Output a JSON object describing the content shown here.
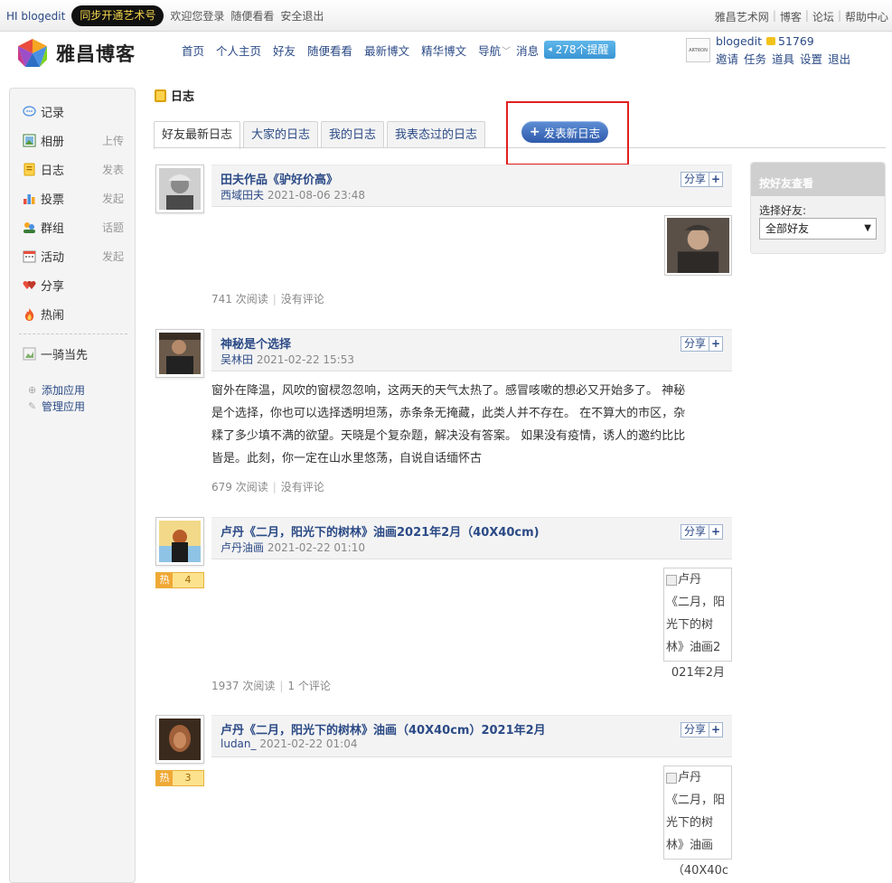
{
  "topbar": {
    "hi": "HI blogedit",
    "sync_pill": "同步开通艺术号",
    "welcome": "欢迎您登录",
    "random": "随便看看",
    "logout": "安全退出",
    "right_links": [
      "雅昌艺术网",
      "博客",
      "论坛",
      "帮助中心"
    ]
  },
  "header": {
    "logo_text": "雅昌博客",
    "nav": [
      "首页",
      "个人主页",
      "好友",
      "随便看看",
      "最新博文",
      "精华博文",
      "导航",
      "消息"
    ],
    "remind": "278个提醒",
    "user": {
      "avatar_text": "ARTRON 雅昌",
      "name": "blogedit",
      "coins": "51769",
      "links": [
        "邀请",
        "任务",
        "道具",
        "设置",
        "退出"
      ]
    }
  },
  "sidebar": {
    "items": [
      {
        "label": "记录",
        "sub": "",
        "icon": "record-icon"
      },
      {
        "label": "相册",
        "sub": "上传",
        "icon": "album-icon"
      },
      {
        "label": "日志",
        "sub": "发表",
        "icon": "blog-icon"
      },
      {
        "label": "投票",
        "sub": "发起",
        "icon": "vote-icon"
      },
      {
        "label": "群组",
        "sub": "话题",
        "icon": "group-icon"
      },
      {
        "label": "活动",
        "sub": "发起",
        "icon": "event-icon"
      },
      {
        "label": "分享",
        "sub": "",
        "icon": "share-icon"
      },
      {
        "label": "热闹",
        "sub": "",
        "icon": "hot-icon"
      }
    ],
    "app": "一骑当先",
    "add_app": "添加应用",
    "manage_app": "管理应用"
  },
  "content": {
    "title": "日志",
    "tabs": [
      "好友最新日志",
      "大家的日志",
      "我的日志",
      "我表态过的日志"
    ],
    "post_button": "发表新日志"
  },
  "feed": [
    {
      "title": "田夫作品《驴好价高》",
      "author": "西域田夫",
      "time": "2021-08-06 23:48",
      "body": "",
      "reads": "741 次阅读",
      "comments": "没有评论",
      "hot": ""
    },
    {
      "title": "神秘是个选择",
      "author": "吴林田",
      "time": "2021-02-22 15:53",
      "body_lines": [
        "窗外在降温，风吹的窗棂忽忽响，这两天的天气太热了。感冒咳嗽的想必又开始多了。 神秘",
        "是个选择，你也可以选择透明坦荡，赤条条无掩藏，此类人并不存在。 在不算大的市区，杂",
        "糅了多少填不满的欲望。天晓是个复杂题，解决没有答案。 如果没有疫情，诱人的邀约比比",
        "皆是。此刻，你一定在山水里悠荡，自说自话缅怀古"
      ],
      "reads": "679 次阅读",
      "comments": "没有评论",
      "hot": ""
    },
    {
      "title": "卢丹《二月，阳光下的树林》油画2021年2月（40X40cm)",
      "author": "卢丹油画",
      "time": "2021-02-22 01:10",
      "image_alt_lines": [
        "卢丹",
        "《二月，阳",
        "光下的树",
        "林》油画2",
        "021年2月"
      ],
      "reads": "1937 次阅读",
      "comments": "1 个评论",
      "hot_label": "热",
      "hot": "4"
    },
    {
      "title": "卢丹《二月，阳光下的树林》油画（40X40cm）2021年2月",
      "author": "ludan_",
      "time": "2021-02-22 01:04",
      "image_alt_lines": [
        "卢丹",
        "《二月，阳",
        "光下的树",
        "林》油画",
        "（40X40c"
      ],
      "hot_label": "热",
      "hot": "3"
    }
  ],
  "share_label": "分享",
  "friend_panel": {
    "header": "按好友查看",
    "label": "选择好友:",
    "selected": "全部好友"
  },
  "colors": {
    "link": "#2b4a86",
    "accent_blue": "#3a95d4",
    "highlight_red": "#e02020"
  }
}
